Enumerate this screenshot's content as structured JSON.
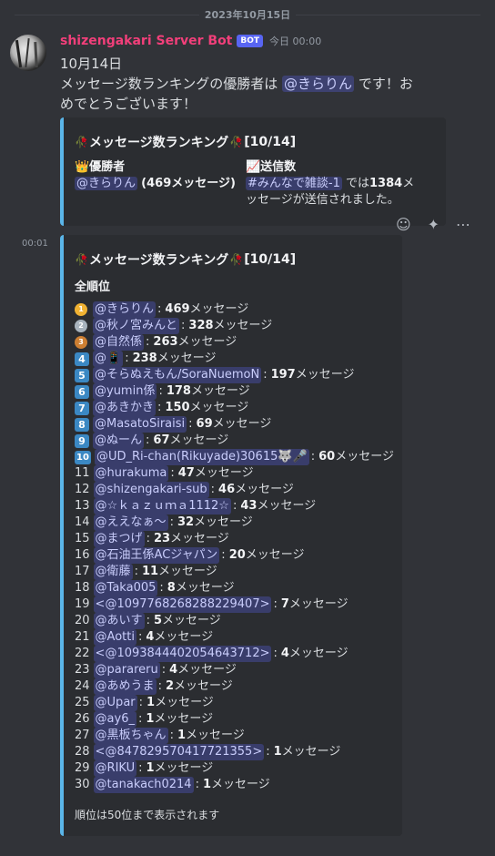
{
  "divider": {
    "date": "2023年10月15日"
  },
  "message": {
    "author": "shizengakari Server Bot",
    "bot_tag": "BOT",
    "timestamp": "今日 00:00",
    "line1": "10月14日",
    "line2_prefix": "メッセージ数ランキングの優勝者は",
    "line2_mention": "@きらりん",
    "line2_suffix": "です！お",
    "line3": "めでとうございます！"
  },
  "embed1": {
    "title": "メッセージ数ランキング",
    "title_suffix": "[10/14]",
    "winner_label": "👑優勝者",
    "winner_mention": "@きらりん",
    "winner_count": "(469メッセージ)",
    "sent_label": "📈送信数",
    "channel": "#みんなで雑談-1",
    "sent_prefix": "では",
    "sent_count": "1384",
    "sent_suffix1": "メ",
    "sent_suffix2": "ッセージが送信されました。"
  },
  "time_left": "00:01",
  "embed2": {
    "title": "メッセージ数ランキング",
    "title_suffix": "[10/14]",
    "section": "全順位",
    "footer": "順位は50位まで表示されます",
    "rows": [
      {
        "rank": "1",
        "style": "gold",
        "name": "@きらりん",
        "count": "469",
        "unit": "メッセージ"
      },
      {
        "rank": "2",
        "style": "silver",
        "name": "@秋ノ宮みんと",
        "count": "328",
        "unit": "メッセージ"
      },
      {
        "rank": "3",
        "style": "bronze",
        "name": "@自然係",
        "count": "263",
        "unit": "メッセージ"
      },
      {
        "rank": "4",
        "style": "keycap",
        "name": "@📱",
        "count": "238",
        "unit": "メッセージ"
      },
      {
        "rank": "5",
        "style": "keycap",
        "name": "@そらぬえもん/SoraNuemoN",
        "count": "197",
        "unit": "メッセージ"
      },
      {
        "rank": "6",
        "style": "keycap",
        "name": "@yumin係",
        "count": "178",
        "unit": "メッセージ"
      },
      {
        "rank": "7",
        "style": "keycap",
        "name": "@あきかき",
        "count": "150",
        "unit": "メッセージ"
      },
      {
        "rank": "8",
        "style": "keycap",
        "name": "@MasatoSiraisi",
        "count": "69",
        "unit": "メッセージ"
      },
      {
        "rank": "9",
        "style": "keycap",
        "name": "@ぬーん",
        "count": "67",
        "unit": "メッセージ"
      },
      {
        "rank": "10",
        "style": "keycap",
        "name": "@UD_Ri-chan(Rikuyade)30615🐺🎤",
        "count": "60",
        "unit": "メッセージ"
      },
      {
        "rank": "11",
        "style": "plain",
        "name": "@hurakuma",
        "count": "47",
        "unit": "メッセージ"
      },
      {
        "rank": "12",
        "style": "plain",
        "name": "@shizengakari-sub",
        "count": "46",
        "unit": "メッセージ"
      },
      {
        "rank": "13",
        "style": "plain",
        "name": "@☆ｋａｚｕｍａ1112☆",
        "count": "43",
        "unit": "メッセージ"
      },
      {
        "rank": "14",
        "style": "plain",
        "name": "@ええなぁ〜",
        "count": "32",
        "unit": "メッセージ"
      },
      {
        "rank": "15",
        "style": "plain",
        "name": "@まつげ",
        "count": "23",
        "unit": "メッセージ"
      },
      {
        "rank": "16",
        "style": "plain",
        "name": "@石油王係ACジャパン",
        "count": "20",
        "unit": "メッセージ"
      },
      {
        "rank": "17",
        "style": "plain",
        "name": "@衛藤",
        "count": "11",
        "unit": "メッセージ"
      },
      {
        "rank": "18",
        "style": "plain",
        "name": "@Taka005",
        "count": "8",
        "unit": "メッセージ"
      },
      {
        "rank": "19",
        "style": "plain",
        "name": "<@1097768268288229407>",
        "count": "7",
        "unit": "メッセージ"
      },
      {
        "rank": "20",
        "style": "plain",
        "name": "@あいす",
        "count": "5",
        "unit": "メッセージ"
      },
      {
        "rank": "21",
        "style": "plain",
        "name": "@Aotti",
        "count": "4",
        "unit": "メッセージ"
      },
      {
        "rank": "22",
        "style": "plain",
        "name": "<@1093844402054643712>",
        "count": "4",
        "unit": "メッセージ"
      },
      {
        "rank": "23",
        "style": "plain",
        "name": "@parareru",
        "count": "4",
        "unit": "メッセージ"
      },
      {
        "rank": "24",
        "style": "plain",
        "name": "@あめうま",
        "count": "2",
        "unit": "メッセージ"
      },
      {
        "rank": "25",
        "style": "plain",
        "name": "@Upar",
        "count": "1",
        "unit": "メッセージ"
      },
      {
        "rank": "26",
        "style": "plain",
        "name": "@ay6_",
        "count": "1",
        "unit": "メッセージ"
      },
      {
        "rank": "27",
        "style": "plain",
        "name": "@黒板ちゃん",
        "count": "1",
        "unit": "メッセージ"
      },
      {
        "rank": "28",
        "style": "plain",
        "name": "<@847829570417721355>",
        "count": "1",
        "unit": "メッセージ"
      },
      {
        "rank": "29",
        "style": "plain",
        "name": "@RIKU",
        "count": "1",
        "unit": "メッセージ"
      },
      {
        "rank": "30",
        "style": "plain",
        "name": "@tanakach0214",
        "count": "1",
        "unit": "メッセージ"
      }
    ]
  },
  "colors": {
    "accent": "#5ab5e8",
    "username": "#f23f7a",
    "bot": "#5865f2",
    "keycap": "#3b88c3"
  },
  "icons": {
    "hover": [
      "add-reaction-icon",
      "add-super-reaction-icon",
      "more-icon"
    ],
    "title": "rose-icon"
  }
}
